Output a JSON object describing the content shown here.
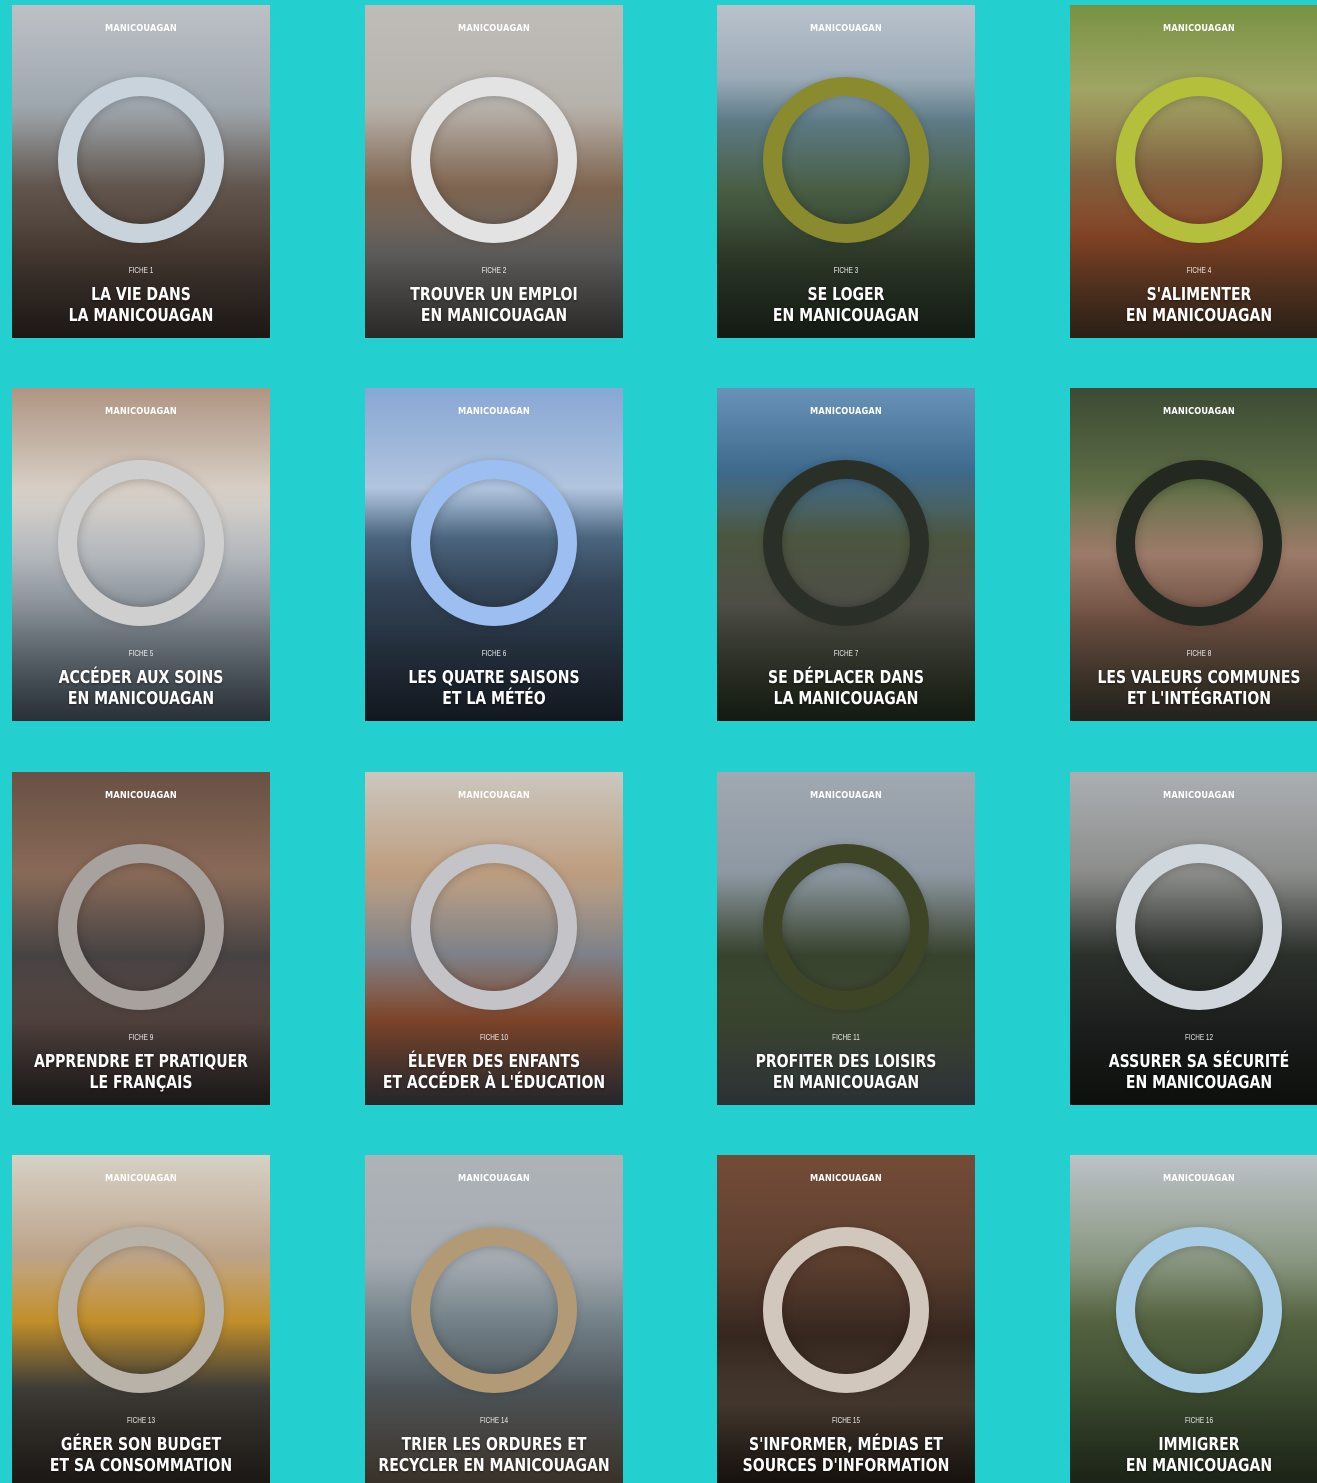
{
  "brand": "MANICOUAGAN",
  "cards": [
    {
      "fiche": "FICHE 1",
      "line1": "LA VIE DANS",
      "line2": "LA MANICOUAGAN",
      "bg": "linear-gradient(180deg,#c7cbd0 0%,#9fa8b0 30%,#6b5e55 55%,#5a4a40 75%,#3f3530 100%)",
      "ring": "#c9d3dc"
    },
    {
      "fiche": "FICHE 2",
      "line1": "TROUVER UN EMPLOI",
      "line2": "EN MANICOUAGAN",
      "bg": "linear-gradient(180deg,#c9c6c2 0%,#b8b3ad 30%,#8c6f58 55%,#7b7a78 75%,#5e5c5a 100%)",
      "ring": "#e3e3e3"
    },
    {
      "fiche": "FICHE 3",
      "line1": "SE LOGER",
      "line2": "EN MANICOUAGAN",
      "bg": "linear-gradient(180deg,#c3ccd6 0%,#9eaebb 22%,#5d7a86 35%,#51694d 55%,#3d4c36 75%,#2c3a2b 100%)",
      "ring": "#8a8a2e"
    },
    {
      "fiche": "FICHE 4",
      "line1": "S'ALIMENTER",
      "line2": "EN MANICOUAGAN",
      "bg": "linear-gradient(180deg,#7e9a46 0%,#a2a765 25%,#8b6b46 50%,#a0522d 70%,#5d4631 100%)",
      "ring": "#b4bf3c"
    },
    {
      "fiche": "FICHE 5",
      "line1": "ACCÉDER AUX SOINS",
      "line2": "EN MANICOUAGAN",
      "bg": "linear-gradient(180deg,#b99d8a 0%,#d8cfc6 30%,#c2c7cc 50%,#8f9aa5 75%,#5b6b7a 100%)",
      "ring": "#cfcfcf"
    },
    {
      "fiche": "FICHE 6",
      "line1": "LES QUATRE SAISONS",
      "line2": "ET LA MÉTÉO",
      "bg": "linear-gradient(180deg,#8fb0e0 0%,#b2c6e0 30%,#4f6a85 45%,#3a4d62 60%,#2a3546 100%)",
      "ring": "#9cbef0"
    },
    {
      "fiche": "FICHE 7",
      "line1": "SE DÉPLACER DANS",
      "line2": "LA MANICOUAGAN",
      "bg": "linear-gradient(180deg,#6f9ac2 0%,#3f6b8e 25%,#4f5a42 45%,#5b5b52 65%,#2e3a26 100%)",
      "ring": "#2a2f28"
    },
    {
      "fiche": "FICHE 8",
      "line1": "LES VALEURS COMMUNES",
      "line2": "ET L'INTÉGRATION",
      "bg": "linear-gradient(180deg,#3f4f37 0%,#5f6f46 30%,#a98472 50%,#85604f 70%,#4a4a3a 100%)",
      "ring": "#232821"
    },
    {
      "fiche": "FICHE 9",
      "line1": "APPRENDRE ET PRATIQUER",
      "line2": "LE FRANÇAIS",
      "bg": "linear-gradient(180deg,#6e5547 0%,#8a6a58 30%,#4f4a4a 55%,#6a5750 75%,#3d3534 100%)",
      "ring": "#a7a29d"
    },
    {
      "fiche": "FICHE 10",
      "line1": "ÉLEVER DES ENFANTS",
      "line2": "ET ACCÉDER À L'ÉDUCATION",
      "bg": "linear-gradient(180deg,#d6d2ca 0%,#bf9e80 30%,#8b8f97 55%,#a85a36 75%,#54545c 100%)",
      "ring": "#c3c3c8"
    },
    {
      "fiche": "FICHE 11",
      "line1": "PROFITER DES LOISIRS",
      "line2": "EN MANICOUAGAN",
      "bg": "linear-gradient(180deg,#a9b1ba 0%,#8e99a4 30%,#3e4a33 55%,#4c5a3d 75%,#5f6b72 100%)",
      "ring": "#3e4426"
    },
    {
      "fiche": "FICHE 12",
      "line1": "ASSURER SA SÉCURITÉ",
      "line2": "EN MANICOUAGAN",
      "bg": "linear-gradient(180deg,#b4b8bc 0%,#8d8e8c 30%,#303530 55%,#262a27 75%,#1e221f 100%)",
      "ring": "#cfd6dc"
    },
    {
      "fiche": "FICHE 13",
      "line1": "GÉRER SON BUDGET",
      "line2": "ET SA CONSOMMATION",
      "bg": "linear-gradient(180deg,#e2dcd0 0%,#bda48a 30%,#d19a2d 50%,#4f4b45 70%,#39332c 100%)",
      "ring": "#b8b2a8"
    },
    {
      "fiche": "FICHE 14",
      "line1": "TRIER LES ORDURES ET",
      "line2": "RECYCLER EN MANICOUAGAN",
      "bg": "linear-gradient(180deg,#b7bcc1 0%,#a7adb3 30%,#7d8b93 50%,#5f6a70 70%,#7b6a58 100%)",
      "ring": "#b29a76"
    },
    {
      "fiche": "FICHE 15",
      "line1": "S'INFORMER, MÉDIAS ET",
      "line2": "SOURCES D'INFORMATION",
      "bg": "linear-gradient(180deg,#7a4f3a 0%,#5e4030 30%,#3b2a22 55%,#5a4a3c 75%,#2f241e 100%)",
      "ring": "#d2c7bd"
    },
    {
      "fiche": "FICHE 16",
      "line1": "IMMIGRER",
      "line2": "EN MANICOUAGAN",
      "bg": "linear-gradient(180deg,#c6cdd2 0%,#8d9a86 30%,#5a6a45 50%,#4c5f3c 70%,#3b4a31 100%)",
      "ring": "#a9cde6"
    }
  ]
}
